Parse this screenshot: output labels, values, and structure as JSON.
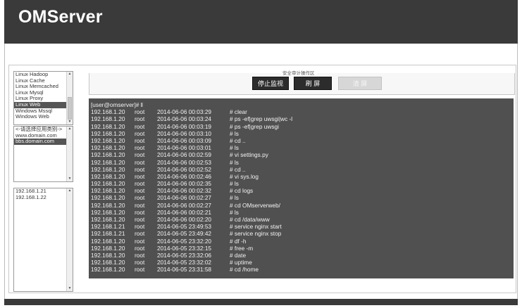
{
  "app": {
    "title": "OMServer"
  },
  "os_list": {
    "items": [
      "Linux Hadoop",
      "Linux Cache",
      "Linux Memcached",
      "Linux Mysql",
      "Linux Proxy",
      "Linux Web",
      "Windows Mssql",
      "Windows Web"
    ],
    "selected": "Linux Web"
  },
  "app_list": {
    "items": [
      "<-请选择应用类别->",
      "www.domain.com",
      "bbs.domain.com"
    ],
    "selected": "bbs.domain.com"
  },
  "host_list": {
    "items": [
      "192.168.1.21",
      "192.168.1.22"
    ]
  },
  "controls": {
    "legend": "安全审计操作区",
    "stop_label": "停止监视",
    "refresh_label": "刷 屏",
    "clear_label": "清 屏"
  },
  "terminal": {
    "prompt": "[user@omserver]# ‖",
    "rows": [
      {
        "ip": "192.168.1.20",
        "user": "root",
        "time": "2014-06-06 00:03:29",
        "cmd": "# clear"
      },
      {
        "ip": "192.168.1.20",
        "user": "root",
        "time": "2014-06-06 00:03:24",
        "cmd": "# ps -ef|grep uwsgi|wc -l"
      },
      {
        "ip": "192.168.1.20",
        "user": "root",
        "time": "2014-06-06 00:03:19",
        "cmd": "# ps -ef|grep uwsgi"
      },
      {
        "ip": "192.168.1.20",
        "user": "root",
        "time": "2014-06-06 00:03:10",
        "cmd": "# ls"
      },
      {
        "ip": "192.168.1.20",
        "user": "root",
        "time": "2014-06-06 00:03:09",
        "cmd": "# cd .."
      },
      {
        "ip": "192.168.1.20",
        "user": "root",
        "time": "2014-06-06 00:03:01",
        "cmd": "# ls"
      },
      {
        "ip": "192.168.1.20",
        "user": "root",
        "time": "2014-06-06 00:02:59",
        "cmd": "# vi settings.py"
      },
      {
        "ip": "192.168.1.20",
        "user": "root",
        "time": "2014-06-06 00:02:53",
        "cmd": "# ls"
      },
      {
        "ip": "192.168.1.20",
        "user": "root",
        "time": "2014-06-06 00:02:52",
        "cmd": "# cd .."
      },
      {
        "ip": "192.168.1.20",
        "user": "root",
        "time": "2014-06-06 00:02:46",
        "cmd": "# vi sys.log"
      },
      {
        "ip": "192.168.1.20",
        "user": "root",
        "time": "2014-06-06 00:02:35",
        "cmd": "# ls"
      },
      {
        "ip": "192.168.1.20",
        "user": "root",
        "time": "2014-06-06 00:02:32",
        "cmd": "# cd logs"
      },
      {
        "ip": "192.168.1.20",
        "user": "root",
        "time": "2014-06-06 00:02:27",
        "cmd": "# ls"
      },
      {
        "ip": "192.168.1.20",
        "user": "root",
        "time": "2014-06-06 00:02:27",
        "cmd": "# cd OMserverweb/"
      },
      {
        "ip": "192.168.1.20",
        "user": "root",
        "time": "2014-06-06 00:02:21",
        "cmd": "# ls"
      },
      {
        "ip": "192.168.1.20",
        "user": "root",
        "time": "2014-06-06 00:02:20",
        "cmd": "# cd /data/www"
      },
      {
        "ip": "192.168.1.21",
        "user": "root",
        "time": "2014-06-05 23:49:53",
        "cmd": "# service nginx start"
      },
      {
        "ip": "192.168.1.21",
        "user": "root",
        "time": "2014-06-05 23:49:42",
        "cmd": "# service nginx stop"
      },
      {
        "ip": "192.168.1.20",
        "user": "root",
        "time": "2014-06-05 23:32:20",
        "cmd": "# df -h"
      },
      {
        "ip": "192.168.1.20",
        "user": "root",
        "time": "2014-06-05 23:32:15",
        "cmd": "# free -m"
      },
      {
        "ip": "192.168.1.20",
        "user": "root",
        "time": "2014-06-05 23:32:06",
        "cmd": "# date"
      },
      {
        "ip": "192.168.1.20",
        "user": "root",
        "time": "2014-06-05 23:32:02",
        "cmd": "# uptime"
      },
      {
        "ip": "192.168.1.20",
        "user": "root",
        "time": "2014-06-05 23:31:58",
        "cmd": "# cd /home"
      }
    ]
  },
  "colors": {
    "header_bg": "#3a3a3a",
    "terminal_bg": "#505050",
    "selected_bg": "#555555"
  }
}
